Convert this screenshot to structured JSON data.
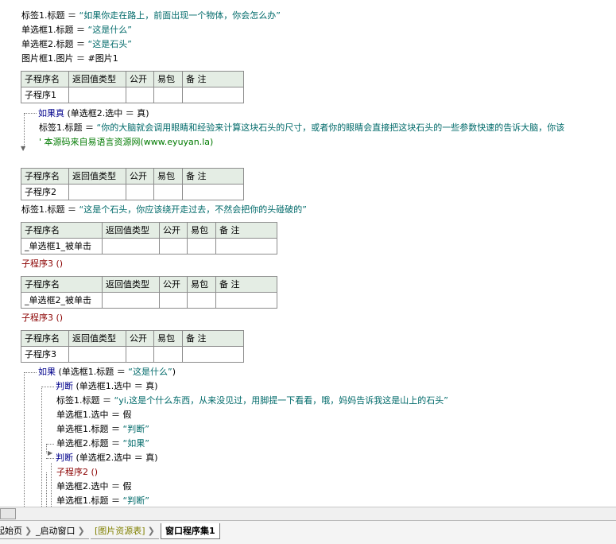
{
  "code": {
    "line1": {
      "lhs": "标签1.标题 ＝ ",
      "str": "“如果你走在路上，前面出现一个物体，你会怎么办”"
    },
    "line2": {
      "lhs": "单选框1.标题 ＝ ",
      "str": "“这是什么”"
    },
    "line3": {
      "lhs": "单选框2.标题 ＝ ",
      "str": "“这是石头”"
    },
    "line4": {
      "text": "图片框1.图片 ＝ #图片1"
    },
    "if1": {
      "kw": "如果真",
      "cond": " (单选框2.选中 ＝ 真)"
    },
    "if1_body": {
      "lhs": "标签1.标题 ＝ ",
      "str": "“你的大脑就会调用眼睛和经验来计算这块石头的尺寸，或者你的眼睛会直接把这块石头的一些参数快速的告诉大脑，你该"
    },
    "comment": "' 本源码来自易语言资源网(www.eyuyan.la)",
    "sub2_body": {
      "lhs": "标签1.标题 ＝ ",
      "str": "“这是个石头，你应该绕开走过去，不然会把你的头碰破的”"
    },
    "call_a": "子程序3 ()",
    "call_b": "子程序3 ()",
    "if2": {
      "kw": "如果",
      "cond": " (单选框1.标题 ＝ ",
      "str": "“这是什么”",
      "close": ")"
    },
    "judge1": {
      "kw": "判断",
      "cond": " (单选框1.选中 ＝ 真)"
    },
    "j1_line1": {
      "lhs": "标签1.标题 ＝ ",
      "str": "“yi,这是个什么东西，从来没见过，用脚提一下看看，哦，妈妈告诉我这是山上的石头”"
    },
    "j1_line2": "单选框1.选中 ＝ 假",
    "j1_line3": {
      "lhs": "单选框1.标题 ＝ ",
      "str": "“判断”"
    },
    "j1_line4": {
      "lhs": "单选框2.标题 ＝ ",
      "str": "“如果”"
    },
    "judge2": {
      "kw": "判断",
      "cond": " (单选框2.选中 ＝ 真)"
    },
    "j2_line1": "子程序2 ()",
    "j2_line2": "单选框2.选中 ＝ 假",
    "j2_line3": {
      "lhs": "单选框1.标题 ＝ ",
      "str": "“判断”"
    }
  },
  "tables": {
    "headers_short": [
      "子程序名",
      "返回值类型",
      "公开",
      "易包",
      "备 注"
    ],
    "headers_long": [
      "子程序名",
      "返回值类型",
      "公开",
      "易包",
      "备 注"
    ],
    "t1_name": "子程序1",
    "t2_name": "子程序2",
    "t3_name": "_单选框1_被单击",
    "t4_name": "_单选框2_被单击",
    "t5_name": "子程序3"
  },
  "tabs": [
    {
      "label": "起始页"
    },
    {
      "label": "_启动窗口"
    },
    {
      "label": "[图片资源表]"
    },
    {
      "label": "窗口程序集1"
    }
  ],
  "colors": {
    "string": "#006a6a",
    "keyword": "#00008b",
    "call": "#8b0000",
    "comment": "#007a00",
    "table_header": "#e4ede4",
    "resource_tab": "#808000"
  }
}
